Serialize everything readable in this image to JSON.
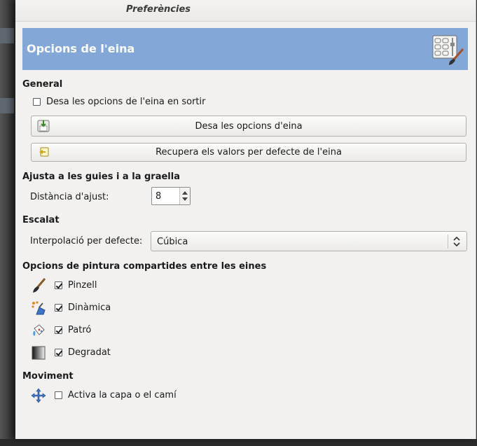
{
  "window": {
    "title": "Preferències"
  },
  "header": {
    "title": "Opcions de l'eina",
    "icon": "tool-options-icon"
  },
  "general": {
    "heading": "General",
    "save_on_exit": {
      "label": "Desa les opcions de l'eina en sortir",
      "checked": false
    },
    "save_button": "Desa les opcions d'eina",
    "reset_button": "Recupera els valors per defecte de l'eina"
  },
  "snap": {
    "heading": "Ajusta a les guies i a la graella",
    "distance_label": "Distància d'ajust:",
    "distance_value": "8"
  },
  "scaling": {
    "heading": "Escalat",
    "interp_label": "Interpolació per defecte:",
    "interp_value": "Cúbica"
  },
  "paint": {
    "heading": "Opcions de pintura compartides entre les eines",
    "items": [
      {
        "label": "Pinzell",
        "checked": true,
        "icon": "paintbrush-icon"
      },
      {
        "label": "Dinàmica",
        "checked": true,
        "icon": "dynamics-icon"
      },
      {
        "label": "Patró",
        "checked": true,
        "icon": "pattern-fill-icon"
      },
      {
        "label": "Degradat",
        "checked": true,
        "icon": "gradient-icon"
      }
    ]
  },
  "move": {
    "heading": "Moviment",
    "activate": {
      "label": "Activa la capa o el camí",
      "checked": false,
      "icon": "move-arrows-icon"
    }
  }
}
